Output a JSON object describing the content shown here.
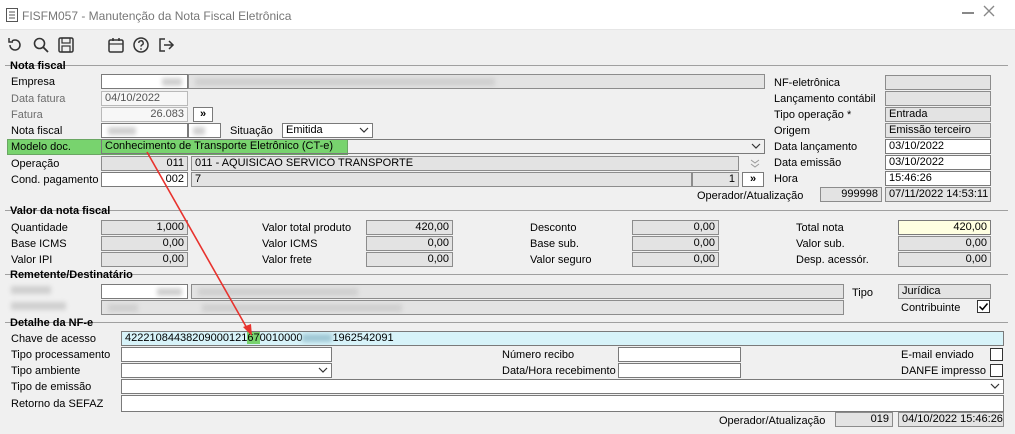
{
  "window": {
    "title": "FISFM057 - Manutenção da Nota Fiscal Eletrônica"
  },
  "toolbar": {
    "icons": [
      "undo-icon",
      "search-icon",
      "save-icon",
      "calendar-icon",
      "help-icon",
      "exit-icon"
    ]
  },
  "nota_fiscal": {
    "title": "Nota fiscal",
    "empresa_label": "Empresa",
    "data_fatura_label": "Data fatura",
    "data_fatura_value": "04/10/2022",
    "fatura_label": "Fatura",
    "fatura_value": "26.083",
    "nota_fiscal_label": "Nota fiscal",
    "situacao_label": "Situação",
    "situacao_value": "Emitida",
    "modelo_label": "Modelo doc.",
    "modelo_value": "Conhecimento de Transporte Eletrônico (CT-e)",
    "operacao_label": "Operação",
    "operacao_code": "011",
    "operacao_desc": "011 - AQUISICAO SERVICO TRANSPORTE",
    "cond_label": "Cond. pagamento",
    "cond_code": "002",
    "cond_desc": "7",
    "cond_count": "1",
    "nfe_label": "NF-eletrônica",
    "lanc_contabil_label": "Lançamento contábil",
    "tipo_operacao_label": "Tipo operação *",
    "tipo_operacao_value": "Entrada",
    "origem_label": "Origem",
    "origem_value": "Emissão terceiro",
    "data_lanc_label": "Data lançamento",
    "data_lanc_value": "03/10/2022",
    "data_emissao_label": "Data emissão",
    "data_emissao_value": "03/10/2022",
    "hora_label": "Hora",
    "hora_value": "15:46:26",
    "operador_label": "Operador/Atualização",
    "operador_code": "999998",
    "operador_datetime": "07/11/2022 14:53:11",
    "nav_btn": "»"
  },
  "valor": {
    "title": "Valor da nota fiscal",
    "quantidade_label": "Quantidade",
    "quantidade_value": "1,000",
    "base_icms_label": "Base ICMS",
    "base_icms_value": "0,00",
    "valor_ipi_label": "Valor IPI",
    "valor_ipi_value": "0,00",
    "total_produto_label": "Valor total produto",
    "total_produto_value": "420,00",
    "valor_icms_label": "Valor ICMS",
    "valor_icms_value": "0,00",
    "valor_frete_label": "Valor frete",
    "valor_frete_value": "0,00",
    "desconto_label": "Desconto",
    "desconto_value": "0,00",
    "base_sub_label": "Base sub.",
    "base_sub_value": "0,00",
    "valor_seguro_label": "Valor seguro",
    "valor_seguro_value": "0,00",
    "total_nota_label": "Total nota",
    "total_nota_value": "420,00",
    "valor_sub_label": "Valor sub.",
    "valor_sub_value": "0,00",
    "desp_acessor_label": "Desp. acessór.",
    "desp_acessor_value": "0,00"
  },
  "remetente": {
    "title": "Remetente/Destinatário",
    "tipo_label": "Tipo",
    "tipo_value": "Jurídica",
    "contribuinte_label": "Contribuinte",
    "contribuinte_checked": true
  },
  "detalhe": {
    "title": "Detalhe da NF-e",
    "chave_label": "Chave de acesso",
    "chave_part1": "42221084438209000121",
    "chave_highlight": "67",
    "chave_part2": "0010000",
    "chave_part3": "1962542091",
    "tipo_proc_label": "Tipo processamento",
    "tipo_amb_label": "Tipo ambiente",
    "tipo_emissao_label": "Tipo de emissão",
    "retorno_label": "Retorno da SEFAZ",
    "numero_recibo_label": "Número recibo",
    "data_receb_label": "Data/Hora recebimento",
    "email_label": "E-mail enviado",
    "danfe_label": "DANFE impresso",
    "operador_label": "Operador/Atualização",
    "operador_code": "019",
    "operador_datetime": "04/10/2022 15:46:26"
  },
  "colors": {
    "highlight_green": "#78d36e",
    "arrow_red": "#e8322d",
    "chave_cyan": "#d7f3f9",
    "total_yellow": "#ffffe1"
  }
}
